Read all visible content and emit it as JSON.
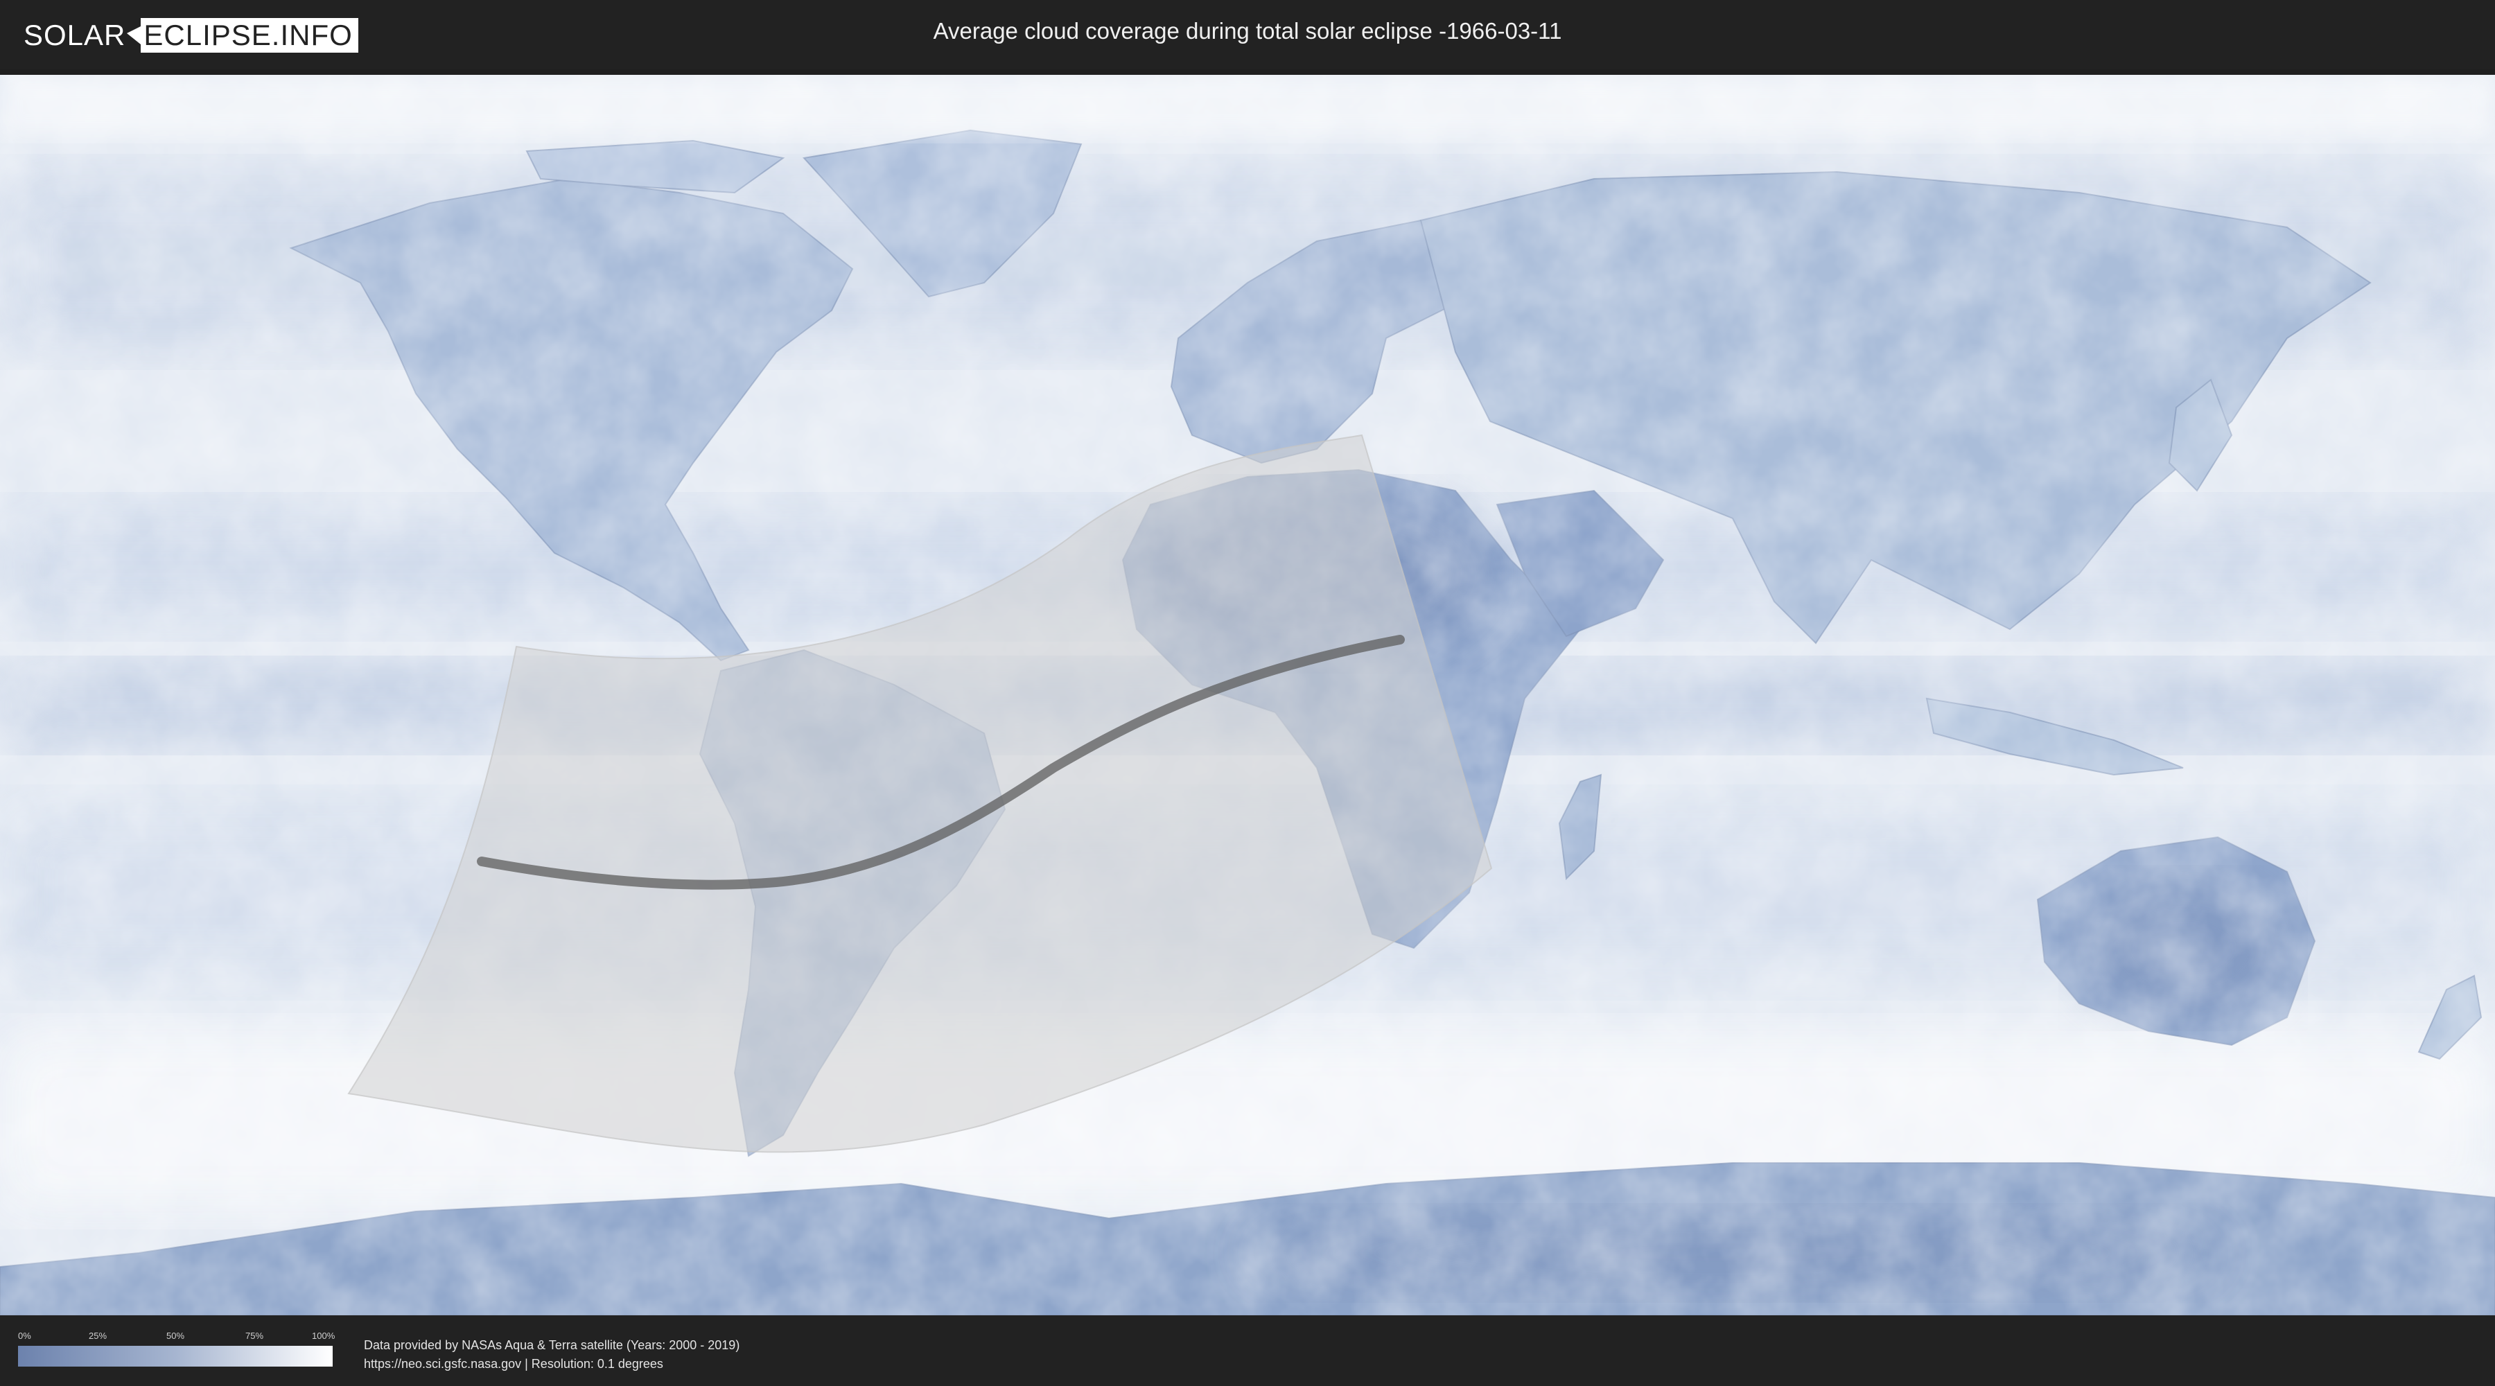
{
  "header": {
    "logo_left": "SOLAR",
    "logo_right": "ECLIPSE.INFO",
    "title": "Average cloud coverage during total solar eclipse -1966-03-11"
  },
  "map": {
    "ocean_color": "#e4eaf3",
    "land_color": "#9fb3d3",
    "dark_cloud_color": "#6f86b3",
    "penumbra_color": "#d2d2d2",
    "central_line_color": "#5e5e5e"
  },
  "legend": {
    "ticks": [
      "0%",
      "25%",
      "50%",
      "75%",
      "100%"
    ],
    "gradient_start": "#6c82ad",
    "gradient_end": "#ffffff"
  },
  "footer": {
    "credit_line1": "Data provided by NASAs Aqua & Terra satellite (Years: 2000 - 2019)",
    "credit_line2": "https://neo.sci.gsfc.nasa.gov | Resolution: 0.1 degrees"
  }
}
